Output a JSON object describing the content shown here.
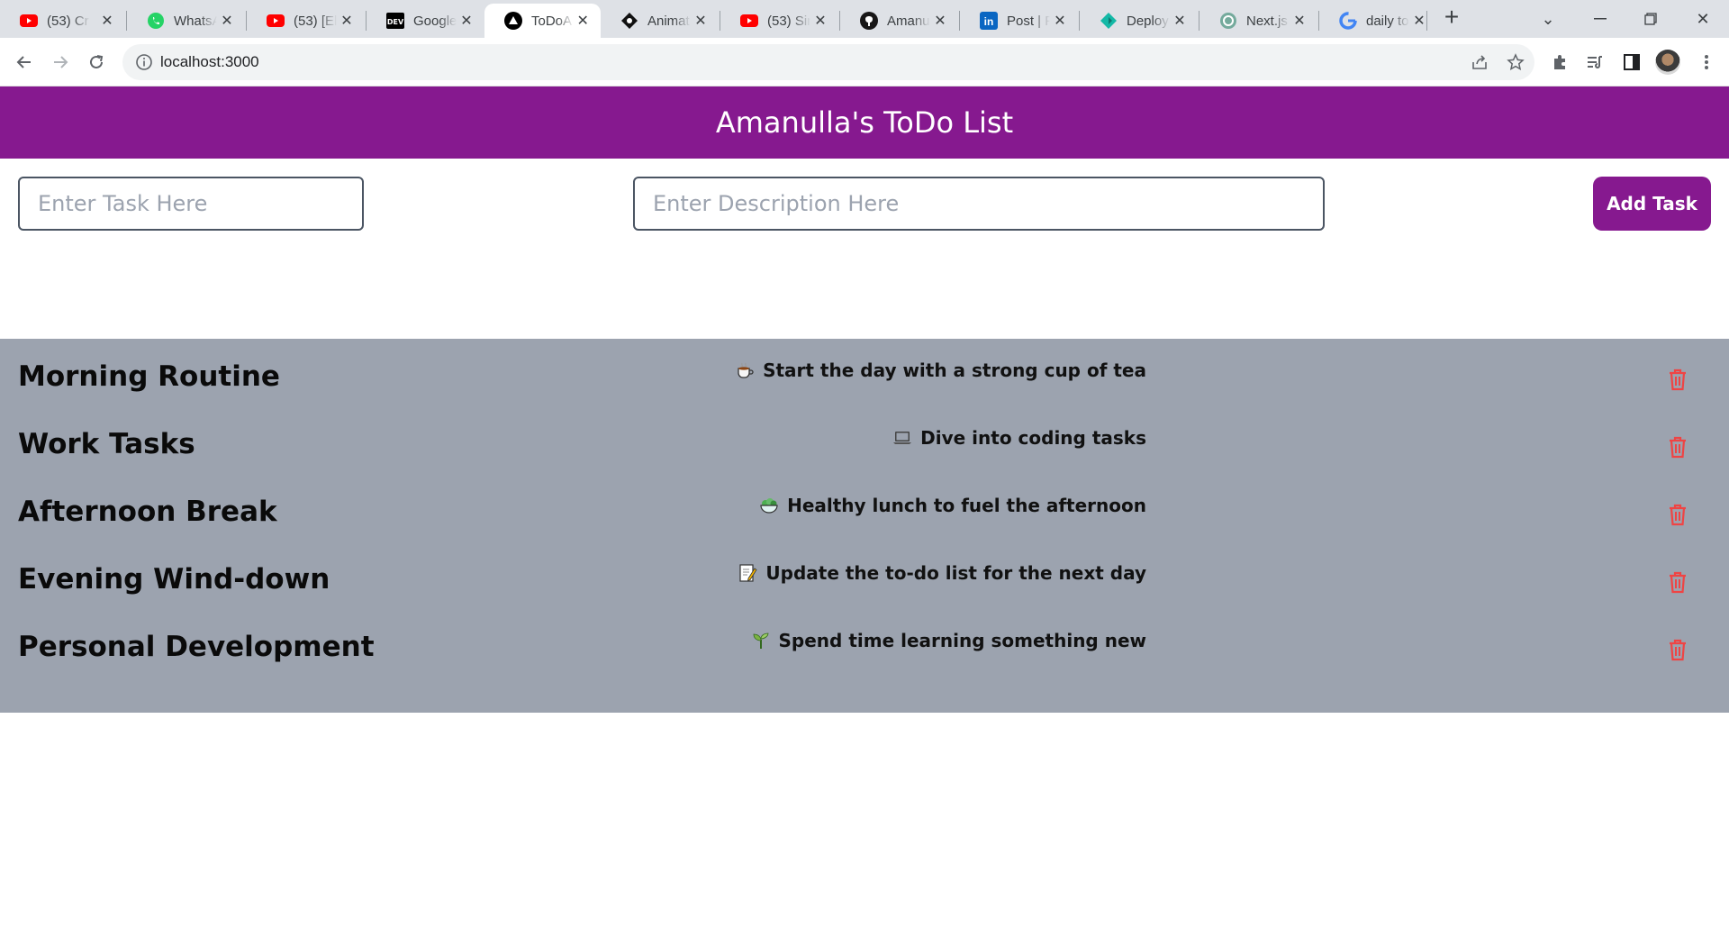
{
  "browser": {
    "tabs": [
      {
        "title": "(53) Cr",
        "icon": "youtube-icon"
      },
      {
        "title": "WhatsA",
        "icon": "whatsapp-icon"
      },
      {
        "title": "(53) [El",
        "icon": "youtube-icon"
      },
      {
        "title": "Google",
        "icon": "dev-icon"
      },
      {
        "title": "ToDoA",
        "icon": "vercel-icon",
        "active": true
      },
      {
        "title": "Animat",
        "icon": "aceternity-icon"
      },
      {
        "title": "(53) Sir",
        "icon": "youtube-icon"
      },
      {
        "title": "Amanu",
        "icon": "github-icon"
      },
      {
        "title": "Post | F",
        "icon": "linkedin-icon"
      },
      {
        "title": "Deploy",
        "icon": "deploy-icon"
      },
      {
        "title": "Next.js",
        "icon": "openai-icon"
      },
      {
        "title": "daily to",
        "icon": "google-icon"
      }
    ],
    "url": "localhost:3000"
  },
  "app": {
    "title": "Amanulla's ToDo List",
    "task_placeholder": "Enter Task Here",
    "description_placeholder": "Enter Description Here",
    "add_button": "Add Task",
    "accent_color": "#86198f",
    "list_background": "#9ca3af",
    "delete_color": "#ef4444",
    "tasks": [
      {
        "title": "Morning Routine",
        "description": "Start the day with a strong cup of tea",
        "emoji": "tea-cup-icon"
      },
      {
        "title": "Work Tasks",
        "description": "Dive into coding tasks",
        "emoji": "laptop-icon"
      },
      {
        "title": "Afternoon Break",
        "description": "Healthy lunch to fuel the afternoon",
        "emoji": "salad-bowl-icon"
      },
      {
        "title": "Evening Wind-down",
        "description": "Update the to-do list for the next day",
        "emoji": "memo-icon"
      },
      {
        "title": "Personal Development",
        "description": "Spend time learning something new",
        "emoji": "seedling-icon"
      }
    ]
  }
}
